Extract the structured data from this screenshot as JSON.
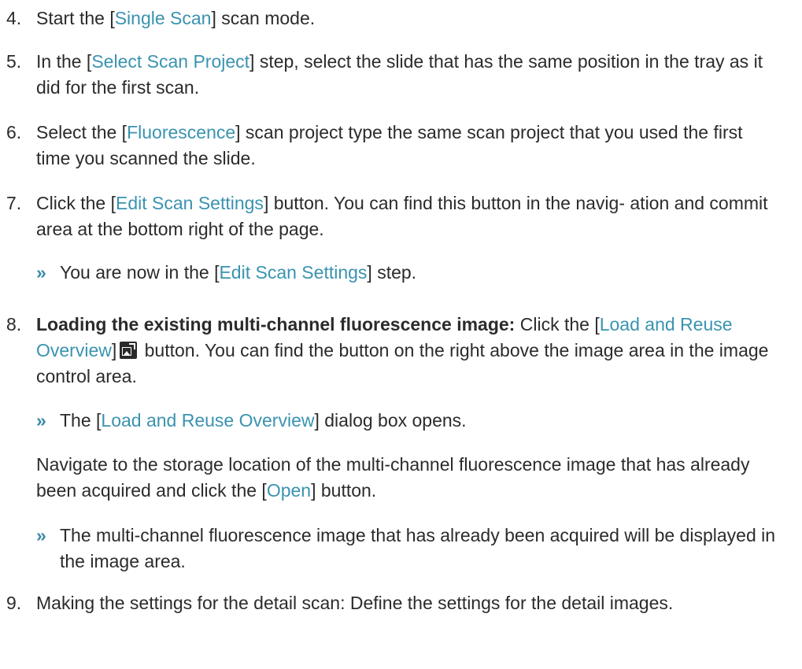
{
  "steps": [
    {
      "num": "4.",
      "pre": "Start the [",
      "ui": "Single Scan",
      "post": "] scan mode."
    },
    {
      "num": "5.",
      "pre": "In the [",
      "ui": "Select Scan Project",
      "post": "] step, select the slide that has the same position in the tray as it did for the first scan."
    },
    {
      "num": "6.",
      "pre": "Select the [",
      "ui": "Fluorescence",
      "post": "] scan project type the same scan project that you used the first time you scanned the slide."
    },
    {
      "num": "7.",
      "pre": "Click the [",
      "ui": "Edit Scan Settings",
      "post": "] button. You can find this button in the navig- ation and commit area at the bottom right of the page.",
      "result": {
        "marker": "»",
        "pre": "You are now in the [",
        "ui": "Edit Scan Settings",
        "post": "] step."
      }
    },
    {
      "num": "8.",
      "bold": "Loading the existing multi-channel fluorescence image:",
      "pre": " Click the [",
      "ui": "Load and Reuse Overview",
      "post": "] button. You can find the button on the right above the image area in the image control area.",
      "icon": "load-reuse-overview-icon",
      "result": {
        "marker": "»",
        "pre": "The [",
        "ui": "Load and Reuse Overview",
        "post": "] dialog box opens."
      },
      "para": {
        "pre": "Navigate to the storage location of the multi-channel fluorescence image that has already been acquired and click the [",
        "ui": "Open",
        "post": "] button."
      },
      "result2": {
        "marker": "»",
        "text": "The multi-channel fluorescence image that has already been acquired will be displayed in the image area."
      }
    },
    {
      "num": "9.",
      "text": "Making the settings for the detail scan: Define the settings for the detail images."
    }
  ],
  "colors": {
    "ui_link": "#3a93b0",
    "body_text": "#2b2b2b"
  }
}
